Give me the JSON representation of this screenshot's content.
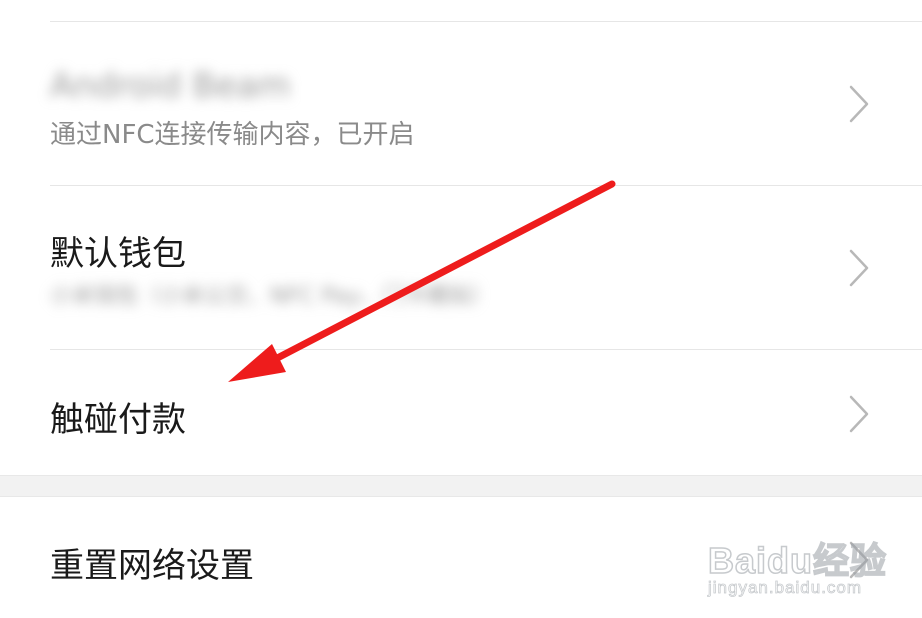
{
  "settings": {
    "items": [
      {
        "title": "Android Beam",
        "subtitle": "通过NFC连接传输内容，已开启"
      },
      {
        "title": "默认钱包",
        "subtitle": "小米钱包（小米公交、NFC Pay、门卡模拟）"
      },
      {
        "title": "触碰付款",
        "subtitle": ""
      },
      {
        "title": "重置网络设置",
        "subtitle": ""
      }
    ]
  },
  "annotation": {
    "arrow_color": "#ee1c1c"
  },
  "watermark": {
    "main": "Baidu经验",
    "sub": "jingyan.baidu.com"
  }
}
